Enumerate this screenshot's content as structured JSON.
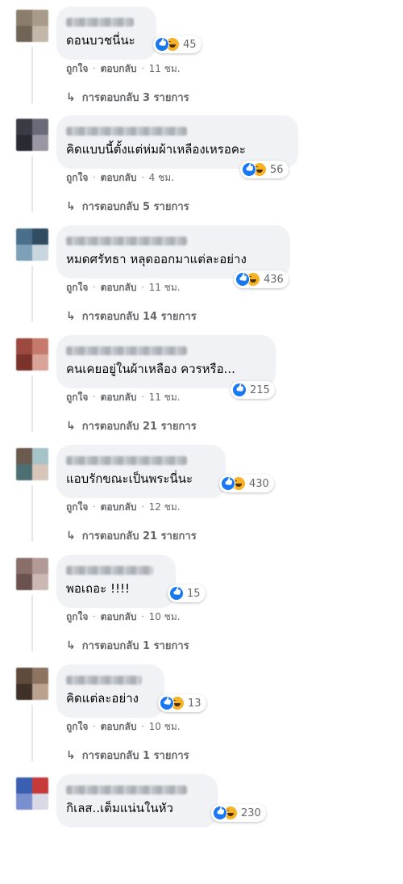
{
  "actions": {
    "like": "ถูกใจ",
    "reply": "ตอบกลับ",
    "separator": "·"
  },
  "reply_arrow": "↳",
  "comments": [
    {
      "text": "ดอนบวชนี่นะ",
      "reactions": [
        "like",
        "haha"
      ],
      "count": "45",
      "time": "11 ชม.",
      "replies": "การตอบกลับ 3 รายการ",
      "avatar": [
        "#8b7d6b",
        "#a89b8a",
        "#6f6456",
        "#c2b7a8"
      ]
    },
    {
      "text": "คิดแบบนี้ตั้งแต่ห่มผ้าเหลืองเหรอคะ",
      "reactions": [
        "like",
        "haha"
      ],
      "count": "56",
      "time": "4 ชม.",
      "replies": "การตอบกลับ 5 รายการ",
      "avatar": [
        "#3b3b46",
        "#6a6a78",
        "#2a2a33",
        "#9a97a3"
      ]
    },
    {
      "text": "หมดศรัทธา หลุดออกมาแต่ละอย่าง",
      "reactions": [
        "like",
        "haha"
      ],
      "count": "436",
      "time": "11 ชม.",
      "replies": "การตอบกลับ 14 รายการ",
      "avatar": [
        "#4a6f8a",
        "#2f4c63",
        "#7da0b8",
        "#c9d6de"
      ]
    },
    {
      "text": "คนเคยอยู่ในผ้าเหลือง ควรหรือ...",
      "reactions": [
        "like"
      ],
      "count": "215",
      "time": "11 ชม.",
      "replies": "การตอบกลับ 21 รายการ",
      "avatar": [
        "#9c4a3f",
        "#c67a6b",
        "#7a332b",
        "#d8a497"
      ]
    },
    {
      "text": "แอบรักขณะเป็นพระนี่นะ",
      "reactions": [
        "like",
        "haha"
      ],
      "count": "430",
      "time": "12 ชม.",
      "replies": "การตอบกลับ 21 รายการ",
      "avatar": [
        "#6b5a4e",
        "#a6c3c9",
        "#4d6f73",
        "#d6c5b8"
      ]
    },
    {
      "text": "พอเถอะ !!!!",
      "reactions": [
        "like"
      ],
      "count": "15",
      "time": "10 ชม.",
      "replies": "การตอบกลับ 1 รายการ",
      "avatar": [
        "#8a6e6a",
        "#b39a96",
        "#6b524f",
        "#cbb7b3"
      ]
    },
    {
      "text": "คิดแต่ละอย่าง",
      "reactions": [
        "like",
        "haha"
      ],
      "count": "13",
      "time": "10 ชม.",
      "replies": "การตอบกลับ 1 รายการ",
      "avatar": [
        "#5e4b3c",
        "#8c7461",
        "#3f3128",
        "#b9a28f"
      ]
    },
    {
      "text": "กิเลส..เต็มแน่นในหัว",
      "reactions": [
        "like",
        "haha"
      ],
      "count": "230",
      "time": "",
      "replies": "",
      "avatar": [
        "#3a5fb0",
        "#c73a3a",
        "#7a8fd0",
        "#d9d9e6"
      ]
    }
  ]
}
